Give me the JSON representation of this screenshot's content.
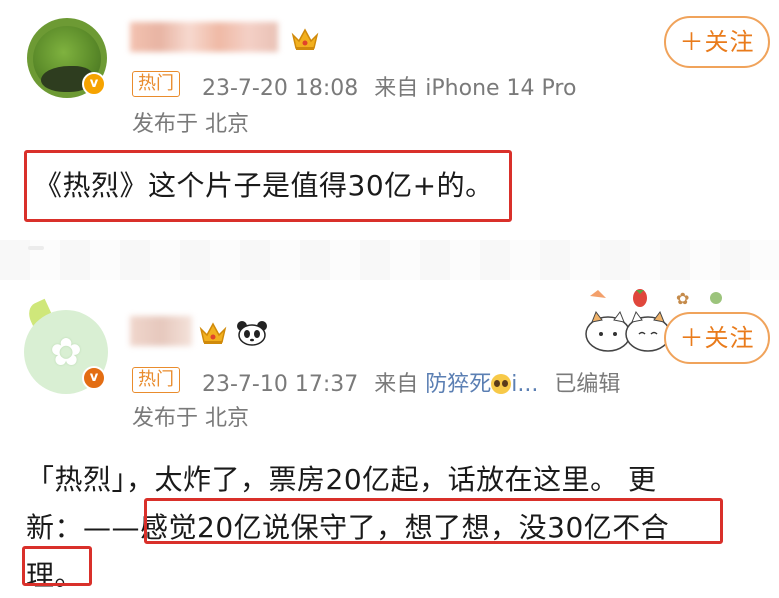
{
  "posts": [
    {
      "follow_label": "＋关注",
      "hot_tag": "热门",
      "datetime": "23-7-20 18:08",
      "source_prefix": "来自",
      "source": "iPhone 14 Pro",
      "location": "发布于 北京",
      "text": "《热烈》这个片子是值得30亿+的。"
    },
    {
      "follow_label": "＋关注",
      "hot_tag": "热门",
      "datetime": "23-7-10 17:37",
      "source_prefix": "来自",
      "source": "防猝死",
      "source_suffix": "i...",
      "edited": "已编辑",
      "location": "发布于 北京",
      "text_line1": "「热烈」，太炸了，票房20亿起，话放在这里。 更",
      "text_line2": "新：——感觉20亿说保守了，想了想，没30亿不合",
      "text_line3": "理。"
    }
  ],
  "colors": {
    "accent_orange": "#e97b1b",
    "highlight_red": "#d9302a",
    "meta_gray": "#7a7a7a"
  },
  "icons": [
    "crown-icon",
    "panda-icon",
    "verified-badge-icon",
    "pleading-face-emoji",
    "cat-stickers"
  ]
}
